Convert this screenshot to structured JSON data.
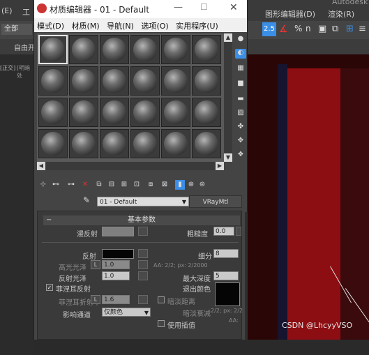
{
  "app": {
    "title_fragment": "Autodesk",
    "left_menu": [
      "(E)",
      "工"
    ],
    "right_menu": [
      "图形编辑器(D)",
      "渲染(R)"
    ],
    "toolbar_left": "全部",
    "tab_left": "自由开",
    "view_label": "[正交]",
    "view_label2": "[明暗处",
    "toolbar_right": [
      "2.5",
      "%",
      "n"
    ]
  },
  "material_editor": {
    "window_title": "材质编辑器 - 01 - Default",
    "menu": [
      "模式(D)",
      "材质(M)",
      "导航(N)",
      "选项(O)",
      "实用程序(U)"
    ],
    "slots": {
      "rows": 4,
      "cols": 6,
      "selected_index": 0
    },
    "material_name": "01 - Default",
    "material_type": "VRayMtl",
    "rollout_title": "基本参数",
    "params": {
      "diffuse_label": "漫反射",
      "roughness_label": "粗糙度",
      "roughness_value": "0.0",
      "reflect_label": "反射",
      "subdivs_label": "细分",
      "subdivs_value": "8",
      "hilight_gloss_label": "高光光泽",
      "hilight_gloss_value": "1.0",
      "lock_label": "L",
      "aa_text": "AA: 2/2; px: 2/2000",
      "refl_gloss_label": "反射光泽",
      "refl_gloss_value": "1.0",
      "max_depth_label": "最大深度",
      "max_depth_value": "5",
      "exit_color_label": "退出颜色",
      "fresnel_label": "菲涅耳反射",
      "fresnel_checked": true,
      "fresnel_ior_label": "菲涅耳折射率",
      "fresnel_ior_value": "1.6",
      "dim_distance_label": "暗淡距离",
      "dim_falloff_label": "暗淡衰减",
      "affect_channels_label": "影响通道",
      "affect_channels_value": "仅颜色",
      "use_interp_label": "使用插值",
      "aa_text2": "2/2; px: 2/2",
      "aa_text3": "AA:"
    }
  },
  "watermark": "CSDN @LhcyyVSO",
  "colors": {
    "viewport_red": "#8c0d12",
    "viewport_dark": "#2a0606",
    "selection_blue": "#3a8ee6"
  }
}
